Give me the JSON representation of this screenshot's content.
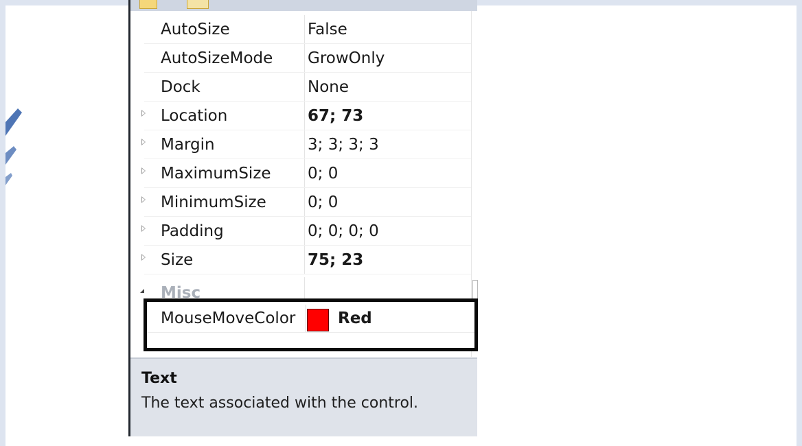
{
  "properties": [
    {
      "name": "AutoSize",
      "value": "False",
      "bold": false,
      "expandable": false
    },
    {
      "name": "AutoSizeMode",
      "value": "GrowOnly",
      "bold": false,
      "expandable": false
    },
    {
      "name": "Dock",
      "value": "None",
      "bold": false,
      "expandable": false
    },
    {
      "name": "Location",
      "value": "67; 73",
      "bold": true,
      "expandable": true
    },
    {
      "name": "Margin",
      "value": "3; 3; 3; 3",
      "bold": false,
      "expandable": true
    },
    {
      "name": "MaximumSize",
      "value": "0; 0",
      "bold": false,
      "expandable": true
    },
    {
      "name": "MinimumSize",
      "value": "0; 0",
      "bold": false,
      "expandable": true
    },
    {
      "name": "Padding",
      "value": "0; 0; 0; 0",
      "bold": false,
      "expandable": true
    },
    {
      "name": "Size",
      "value": "75; 23",
      "bold": true,
      "expandable": true
    }
  ],
  "misc_category": {
    "label": "Misc",
    "collapse_icon": "collapse-arrow-icon"
  },
  "highlighted_property": {
    "name": "MouseMoveColor",
    "value": "Red",
    "swatch_color": "#ff0000"
  },
  "description": {
    "title": "Text",
    "text": "The text associated with the control."
  },
  "colors": {
    "panel_background": "#ffffff",
    "description_background": "#dfe3ea",
    "highlight_border": "#0a0a0a",
    "category_text": "#aab0b9"
  }
}
